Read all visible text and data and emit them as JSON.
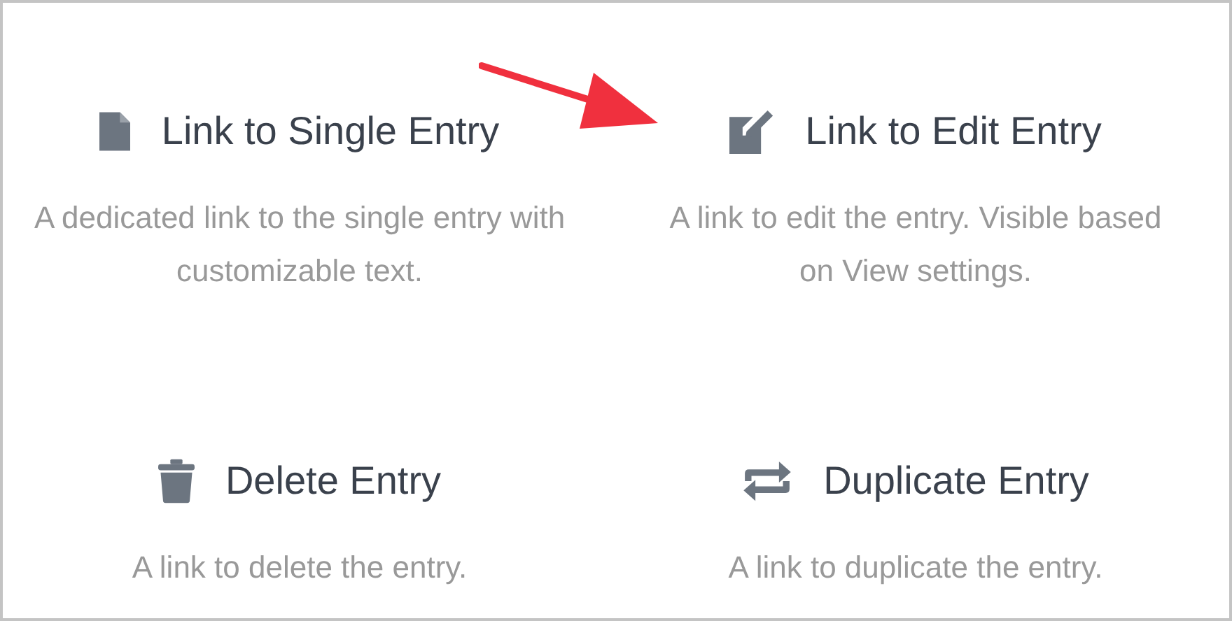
{
  "fields": [
    {
      "title": "Link to Single Entry",
      "description": "A dedicated link to the single entry with customizable text."
    },
    {
      "title": "Link to Edit Entry",
      "description": "A link to edit the entry. Visible based on View settings."
    },
    {
      "title": "Delete Entry",
      "description": "A link to delete the entry."
    },
    {
      "title": "Duplicate Entry",
      "description": "A link to duplicate the entry."
    }
  ]
}
